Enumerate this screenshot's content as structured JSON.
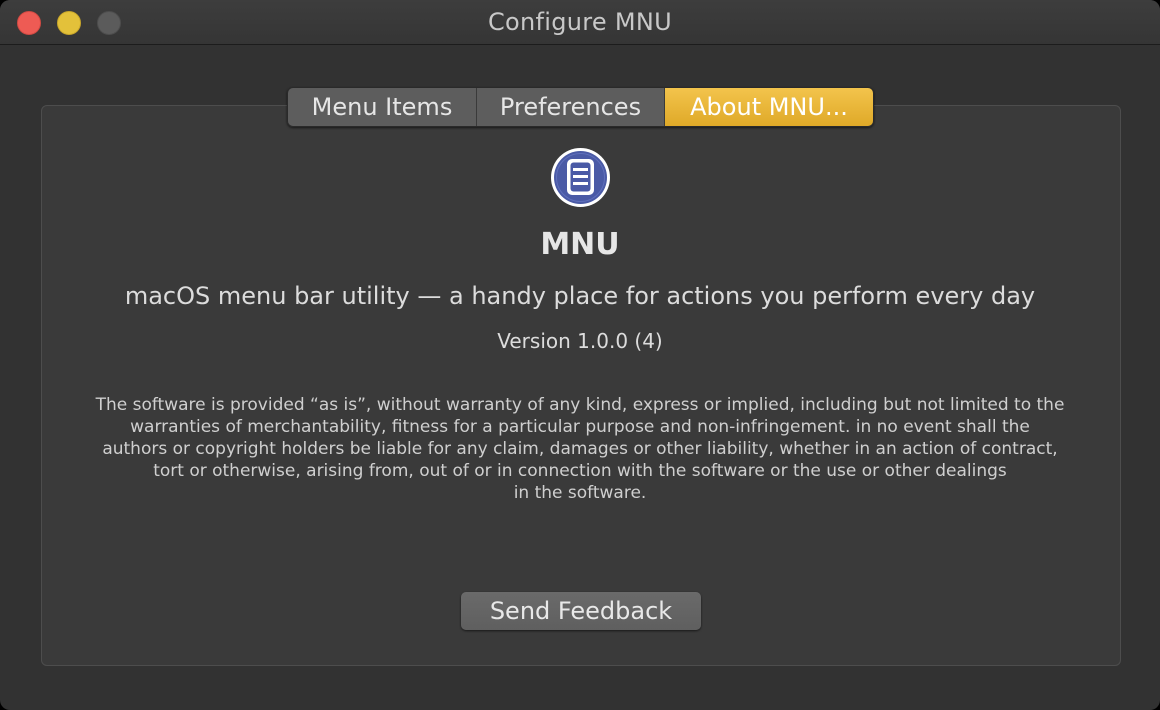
{
  "window": {
    "title": "Configure MNU"
  },
  "tabs": [
    {
      "label": "Menu Items",
      "selected": false
    },
    {
      "label": "Preferences",
      "selected": false
    },
    {
      "label": "About MNU...",
      "selected": true
    }
  ],
  "about": {
    "icon": "menu-list-icon",
    "app_name": "MNU",
    "tagline": "macOS menu bar utility — a handy place for actions you perform every day",
    "version": "Version 1.0.0 (4)",
    "license_lines": [
      "The software is provided “as is”, without warranty of any kind, express or implied, including but not limited to the",
      "warranties of merchantability, fitness for a particular purpose and  non-infringement. in no event shall the",
      "authors or copyright holders be liable for any claim, damages or other liability, whether in an action of contract,",
      "tort or otherwise, arising from, out of or in connection with the software or the use or other dealings",
      "in the software."
    ],
    "feedback_button": "Send Feedback"
  },
  "colors": {
    "accent": "#e8b535",
    "window_bg": "#323232",
    "icon_blue": "#4a5aa6"
  }
}
